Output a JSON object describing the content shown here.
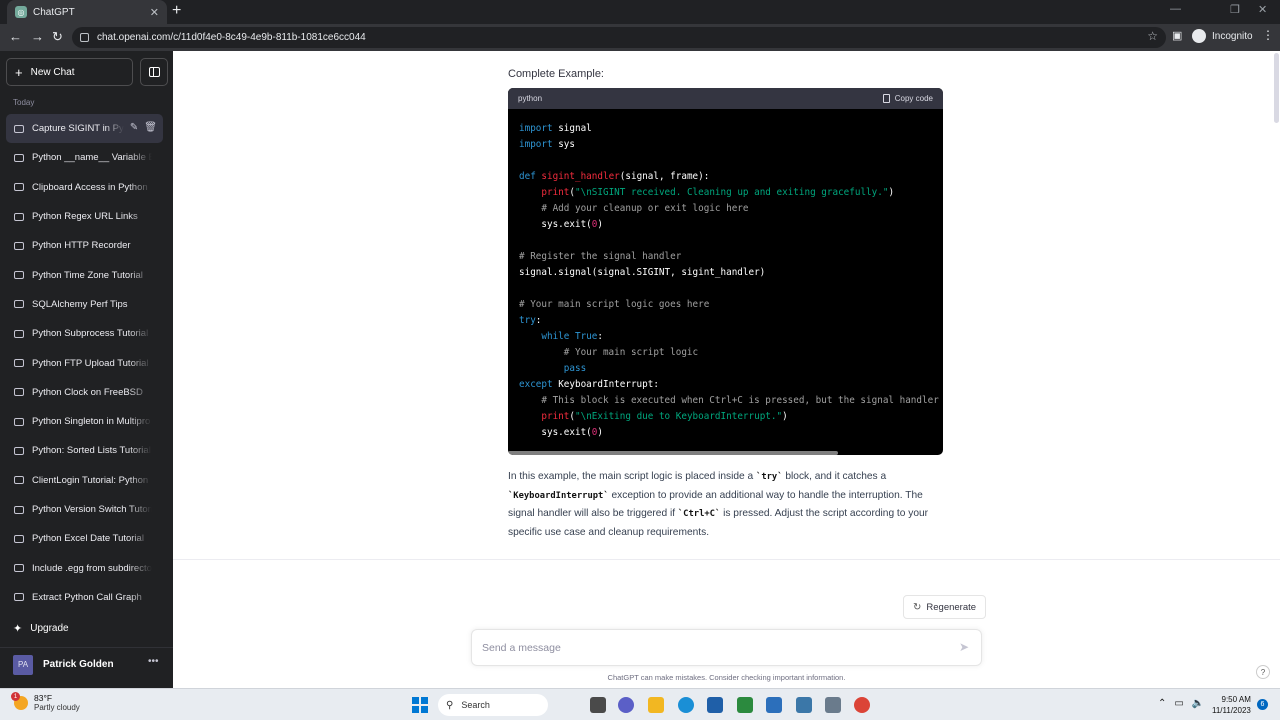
{
  "browser": {
    "tab_title": "ChatGPT",
    "tab_close": "✕",
    "new_tab": "+",
    "url": "chat.openai.com/c/11d0f4e0-8c49-4e9b-811b-1081ce6cc044",
    "profile": "Incognito"
  },
  "sidebar": {
    "new_chat": "New Chat",
    "section": "Today",
    "items": [
      "Capture SIGINT in Pyt",
      "Python __name__ Variable Ex",
      "Clipboard Access in Python",
      "Python Regex URL Links",
      "Python HTTP Recorder",
      "Python Time Zone Tutorial",
      "SQLAlchemy Perf Tips",
      "Python Subprocess Tutorial",
      "Python FTP Upload Tutorial",
      "Python Clock on FreeBSD",
      "Python Singleton in Multipro",
      "Python: Sorted Lists Tutorial",
      "ClientLogin Tutorial: Python",
      "Python Version Switch Tutori",
      "Python Excel Date Tutorial",
      "Include .egg from subdirector",
      "Extract Python Call Graph"
    ],
    "upgrade": "Upgrade",
    "user_initials": "PA",
    "user_name": "Patrick Golden"
  },
  "conversation": {
    "heading": "Complete Example:",
    "code_lang": "python",
    "copy_label": "Copy code",
    "paragraph": {
      "t1": "In this example, the main script logic is placed inside a ",
      "c1": "`try`",
      "t2": " block, and it catches a ",
      "c2": "`KeyboardInterrupt`",
      "t3": " exception to provide an additional way to handle the interruption. The signal handler will also be triggered if ",
      "c3": "`Ctrl+C`",
      "t4": " is pressed. Adjust the script according to your specific use case and cleanup requirements."
    }
  },
  "composer": {
    "regenerate": "Regenerate",
    "placeholder": "Send a message",
    "disclaimer": "ChatGPT can make mistakes. Consider checking important information.",
    "help": "?"
  },
  "taskbar": {
    "weather_temp": "83°F",
    "weather_cond": "Partly cloudy",
    "weather_badge": "1",
    "search": "Search",
    "time": "9:50 AM",
    "date": "11/11/2023",
    "notifications": "6"
  }
}
